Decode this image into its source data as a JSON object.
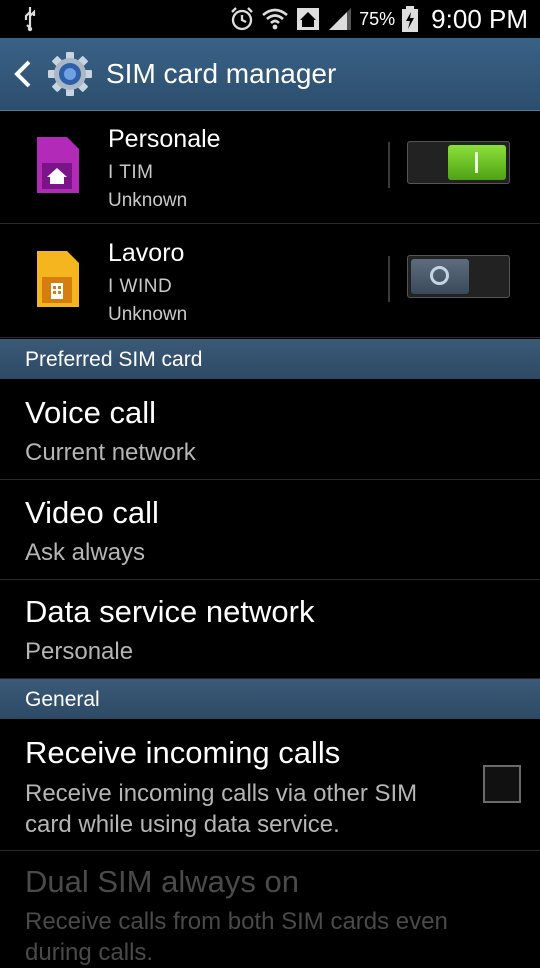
{
  "statusbar": {
    "battery_pct": "75%",
    "time": "9:00 PM",
    "icons": [
      "usb-icon",
      "alarm-icon",
      "wifi-icon",
      "home-network-icon",
      "signal-icon",
      "battery-charging-icon"
    ]
  },
  "actionbar": {
    "title": "SIM card manager",
    "icons": [
      "back-icon",
      "settings-gear-icon"
    ]
  },
  "sims": [
    {
      "name": "Personale",
      "operator": "I TIM",
      "status": "Unknown",
      "enabled": true,
      "icon": "sim-home-icon",
      "color": "#b12bb8"
    },
    {
      "name": "Lavoro",
      "operator": "I WIND",
      "status": "Unknown",
      "enabled": false,
      "icon": "sim-work-icon",
      "color": "#f0a11a"
    }
  ],
  "preferred": {
    "header": "Preferred SIM card",
    "items": [
      {
        "title": "Voice call",
        "value": "Current network"
      },
      {
        "title": "Video call",
        "value": "Ask always"
      },
      {
        "title": "Data service network",
        "value": "Personale"
      }
    ]
  },
  "general": {
    "header": "General",
    "receive_incoming": {
      "title": "Receive incoming calls",
      "desc_line1": "Receive incoming calls via other SIM",
      "desc_line2": "card while using data service.",
      "checked": false
    },
    "dual_sim": {
      "title": "Dual SIM always on",
      "desc_line1": "Receive calls from both SIM cards even",
      "desc_line2": "during calls.",
      "enabled": false
    }
  },
  "colors": {
    "accent_green": "#6cc62a",
    "actionbar": "#34597c",
    "section": "#34536f"
  }
}
